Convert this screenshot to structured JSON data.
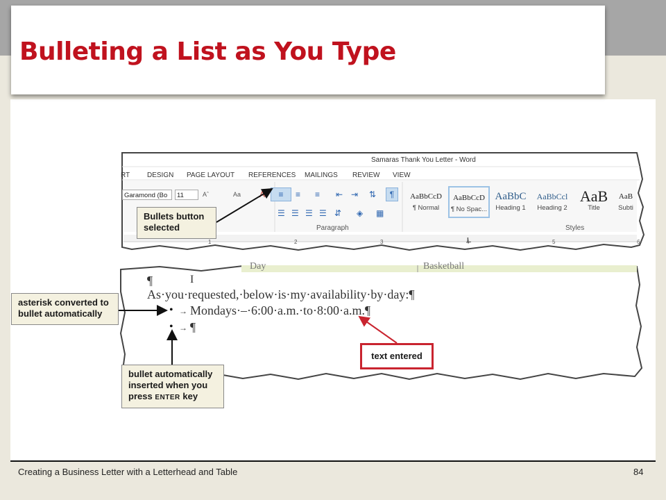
{
  "slide": {
    "title": "Bulleting a List as You Type",
    "footer": "Creating a Business Letter with a Letterhead and Table",
    "page_number": "84"
  },
  "colors": {
    "title": "#c0121e",
    "callout_bg": "#f4f1e0",
    "callout_red": "#c9242f",
    "ribbon_selected": "#c6dcf0"
  },
  "ribbon": {
    "window_title": "Samaras Thank You Letter - Word",
    "tabs": [
      "RT",
      "DESIGN",
      "PAGE LAYOUT",
      "REFERENCES",
      "MAILINGS",
      "REVIEW",
      "VIEW"
    ],
    "font_name": "Garamond (Bo",
    "font_size": "11",
    "grow_font": "Aˆ",
    "font_case": "Aa",
    "bullets_icon": "list-bullets-icon",
    "pilcrow": "¶",
    "styles": [
      {
        "preview": "AaBbCcD",
        "name": "¶ Normal"
      },
      {
        "preview": "AaBbCcD",
        "name": "¶ No Spac..."
      },
      {
        "preview": "AaBbC",
        "name": "Heading 1"
      },
      {
        "preview": "AaBbCcl",
        "name": "Heading 2"
      },
      {
        "preview": "AaB",
        "name": "Title"
      },
      {
        "preview": "AaB",
        "name": "Subti"
      }
    ],
    "group_paragraph": "Paragraph",
    "group_styles": "Styles",
    "ruler_numbers": [
      "1",
      "2",
      "3",
      "4",
      "5",
      "6"
    ],
    "ruler_mark": "L"
  },
  "document": {
    "table_peek_left": "Day",
    "table_peek_right": "Basketball",
    "line1_pilcrow": "¶",
    "cursor": "I",
    "line2": "As·you·requested,·below·is·my·availability·by·day:¶",
    "bullet1_text": "Mondays·–·6:00·a.m.·to·8:00·a.m.¶",
    "bullet2_text": "¶",
    "bullet_char": "•",
    "tab_char": "→"
  },
  "callouts": {
    "bullets_selected": "Bullets button selected",
    "asterisk_converted": "asterisk converted to bullet automatically",
    "inserted_prefix": "bullet automatically inserted when you press",
    "inserted_key": "ENTER",
    "inserted_suffix": "key",
    "text_entered": "text entered"
  }
}
